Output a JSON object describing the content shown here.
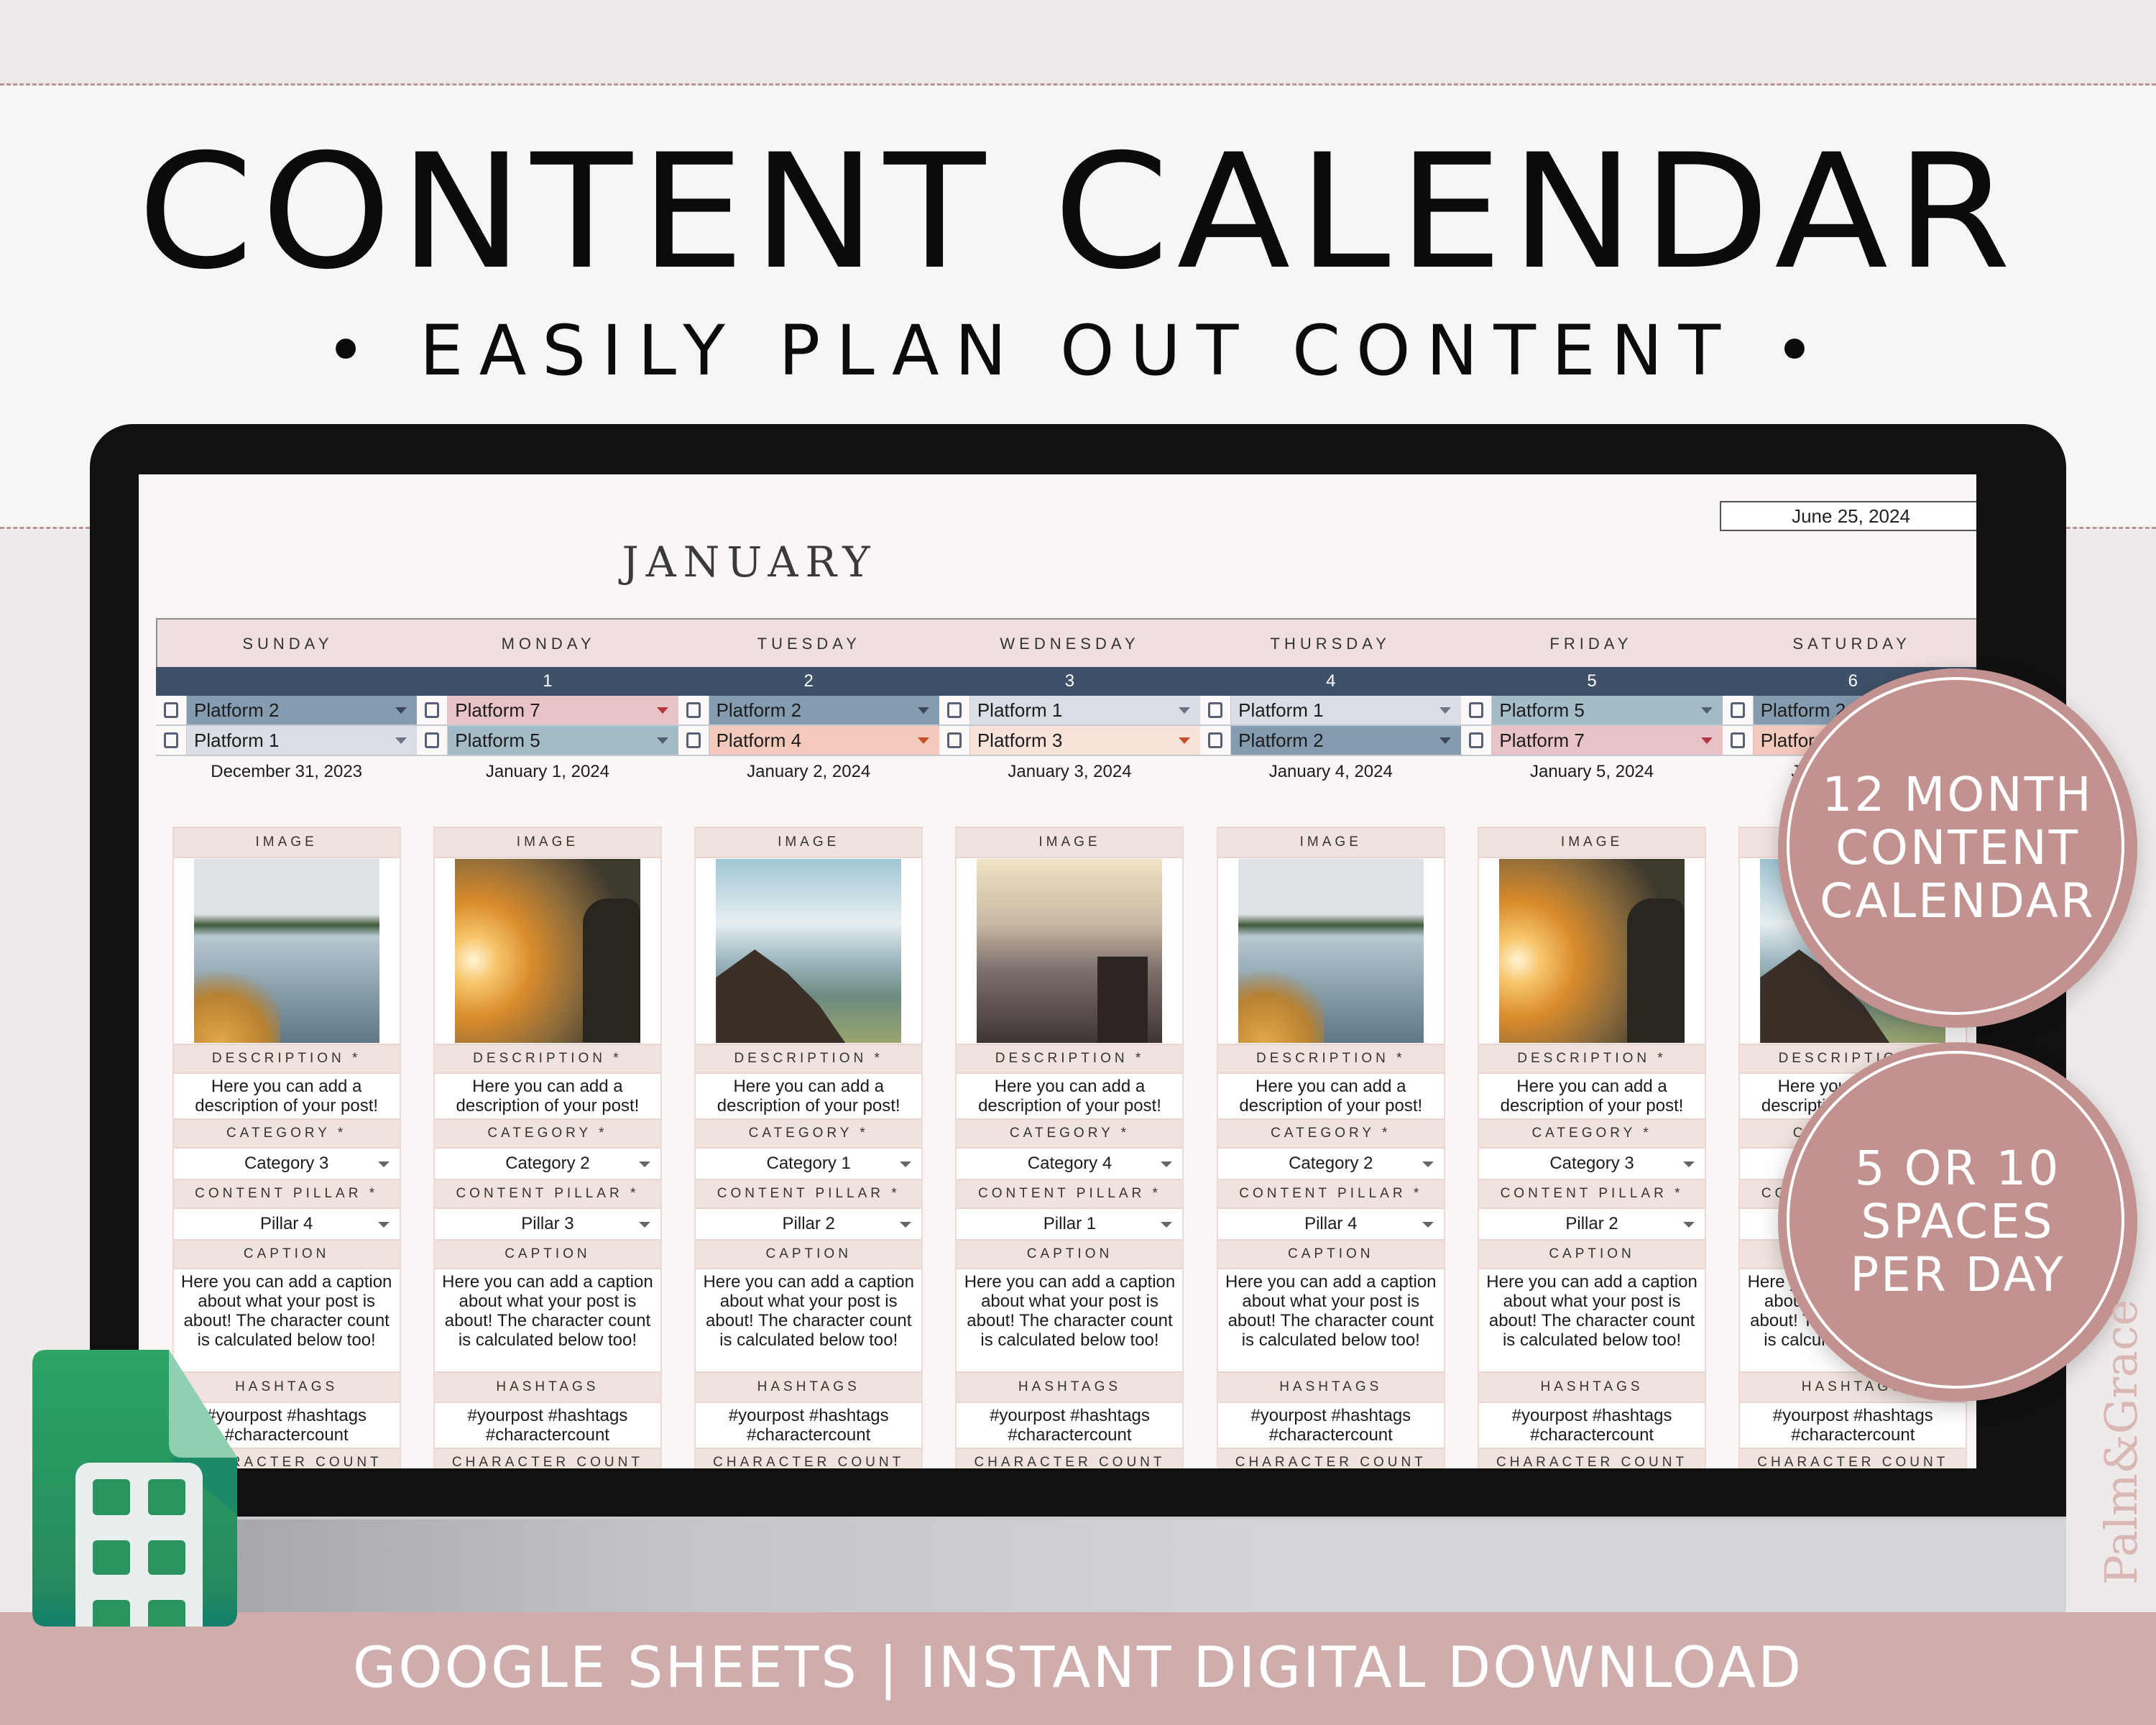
{
  "header": {
    "title": "CONTENT CALENDAR",
    "subtitle": "• EASILY PLAN OUT CONTENT •"
  },
  "sheet": {
    "current_date": "June 25, 2024",
    "month": "JANUARY",
    "weekdays": [
      "SUNDAY",
      "MONDAY",
      "TUESDAY",
      "WEDNESDAY",
      "THURSDAY",
      "FRIDAY",
      "SATURDAY"
    ],
    "day_numbers": [
      "",
      "1",
      "2",
      "3",
      "4",
      "5",
      "6"
    ],
    "platforms_row1": [
      {
        "label": "Platform 2",
        "color": "#849bb0",
        "arrow": "#3b4656"
      },
      {
        "label": "Platform 7",
        "color": "#e8c2c5",
        "arrow": "#b3373f"
      },
      {
        "label": "Platform 2",
        "color": "#849bb0",
        "arrow": "#3b4656"
      },
      {
        "label": "Platform 1",
        "color": "#d9dde4",
        "arrow": "#6b7585"
      },
      {
        "label": "Platform 1",
        "color": "#d9dde4",
        "arrow": "#6b7585"
      },
      {
        "label": "Platform 5",
        "color": "#a4bcc7",
        "arrow": "#4f5f6d"
      },
      {
        "label": "Platform 2",
        "color": "#849bb0",
        "arrow": "#3b4656"
      }
    ],
    "platforms_row2": [
      {
        "label": "Platform 1",
        "color": "#d9dde4",
        "arrow": "#6b7585"
      },
      {
        "label": "Platform 5",
        "color": "#a4bcc7",
        "arrow": "#4f5f6d"
      },
      {
        "label": "Platform 4",
        "color": "#f3c9bb",
        "arrow": "#c6502a"
      },
      {
        "label": "Platform 3",
        "color": "#f8e2da",
        "arrow": "#c6502a"
      },
      {
        "label": "Platform 2",
        "color": "#849bb0",
        "arrow": "#3b4656"
      },
      {
        "label": "Platform 7",
        "color": "#e8c2c5",
        "arrow": "#b3373f"
      },
      {
        "label": "Platform 4",
        "color": "#f3c9bb",
        "arrow": "#c6502a"
      }
    ],
    "dates": [
      "December 31, 2023",
      "January 1, 2024",
      "January 2, 2024",
      "January 3, 2024",
      "January 4, 2024",
      "January 5, 2024",
      "January 6, 2024"
    ],
    "section_labels": {
      "image": "IMAGE",
      "description": "DESCRIPTION *",
      "category": "CATEGORY *",
      "pillar": "CONTENT PILLAR *",
      "caption": "CAPTION",
      "hashtags": "HASHTAGS",
      "character_count": "CHARACTER COUNT"
    },
    "cards": [
      {
        "image": "kayak",
        "description": "Here you can add a description of your post!",
        "category": "Category 3",
        "pillar": "Pillar 4",
        "caption": "Here you can add a caption about what your post is about! The character count is calculated below too!",
        "hashtags": "#yourpost #hashtags #charactercount"
      },
      {
        "image": "sunset",
        "description": "Here you can add a description of your post!",
        "category": "Category 2",
        "pillar": "Pillar 3",
        "caption": "Here you can add a caption about what your post is about! The character count is calculated below too!",
        "hashtags": "#yourpost #hashtags #charactercount"
      },
      {
        "image": "peak",
        "description": "Here you can add a description of your post!",
        "category": "Category 1",
        "pillar": "Pillar 2",
        "caption": "Here you can add a caption about what your post is about! The character count is calculated below too!",
        "hashtags": "#yourpost #hashtags #charactercount"
      },
      {
        "image": "misty",
        "description": "Here you can add a description of your post!",
        "category": "Category 4",
        "pillar": "Pillar 1",
        "caption": "Here you can add a caption about what your post is about! The character count is calculated below too!",
        "hashtags": "#yourpost #hashtags #charactercount"
      },
      {
        "image": "kayak",
        "description": "Here you can add a description of your post!",
        "category": "Category 2",
        "pillar": "Pillar 4",
        "caption": "Here you can add a caption about what your post is about! The character count is calculated below too!",
        "hashtags": "#yourpost #hashtags #charactercount"
      },
      {
        "image": "sunset",
        "description": "Here you can add a description of your post!",
        "category": "Category 3",
        "pillar": "Pillar 2",
        "caption": "Here you can add a caption about what your post is about! The character count is calculated below too!",
        "hashtags": "#yourpost #hashtags #charactercount"
      },
      {
        "image": "peak",
        "description": "Here you can add a description of your post!",
        "category": "",
        "pillar": "",
        "caption": "Here you can add a caption about what your post is about! The character count is calculated below too!",
        "hashtags": "#yourpost #hashtags #charactercount"
      }
    ]
  },
  "badges": [
    {
      "text": "12 MONTH\nCONTENT\nCALENDAR"
    },
    {
      "text": "5 OR 10\nSPACES\nPER DAY"
    }
  ],
  "footer": {
    "text": "GOOGLE SHEETS | INSTANT DIGITAL DOWNLOAD"
  },
  "brand": {
    "name": "Palm&Grace"
  },
  "icons": {
    "sheets": "google-sheets-icon",
    "checkbox": "checkbox-icon",
    "dropdown": "dropdown-arrow-icon"
  },
  "colors": {
    "accent": "#c29290",
    "footer_band": "#ceadac",
    "day_number_bar": "#3e5168",
    "weekday_header": "#efdfdf",
    "section_header": "#f0e3dd"
  }
}
